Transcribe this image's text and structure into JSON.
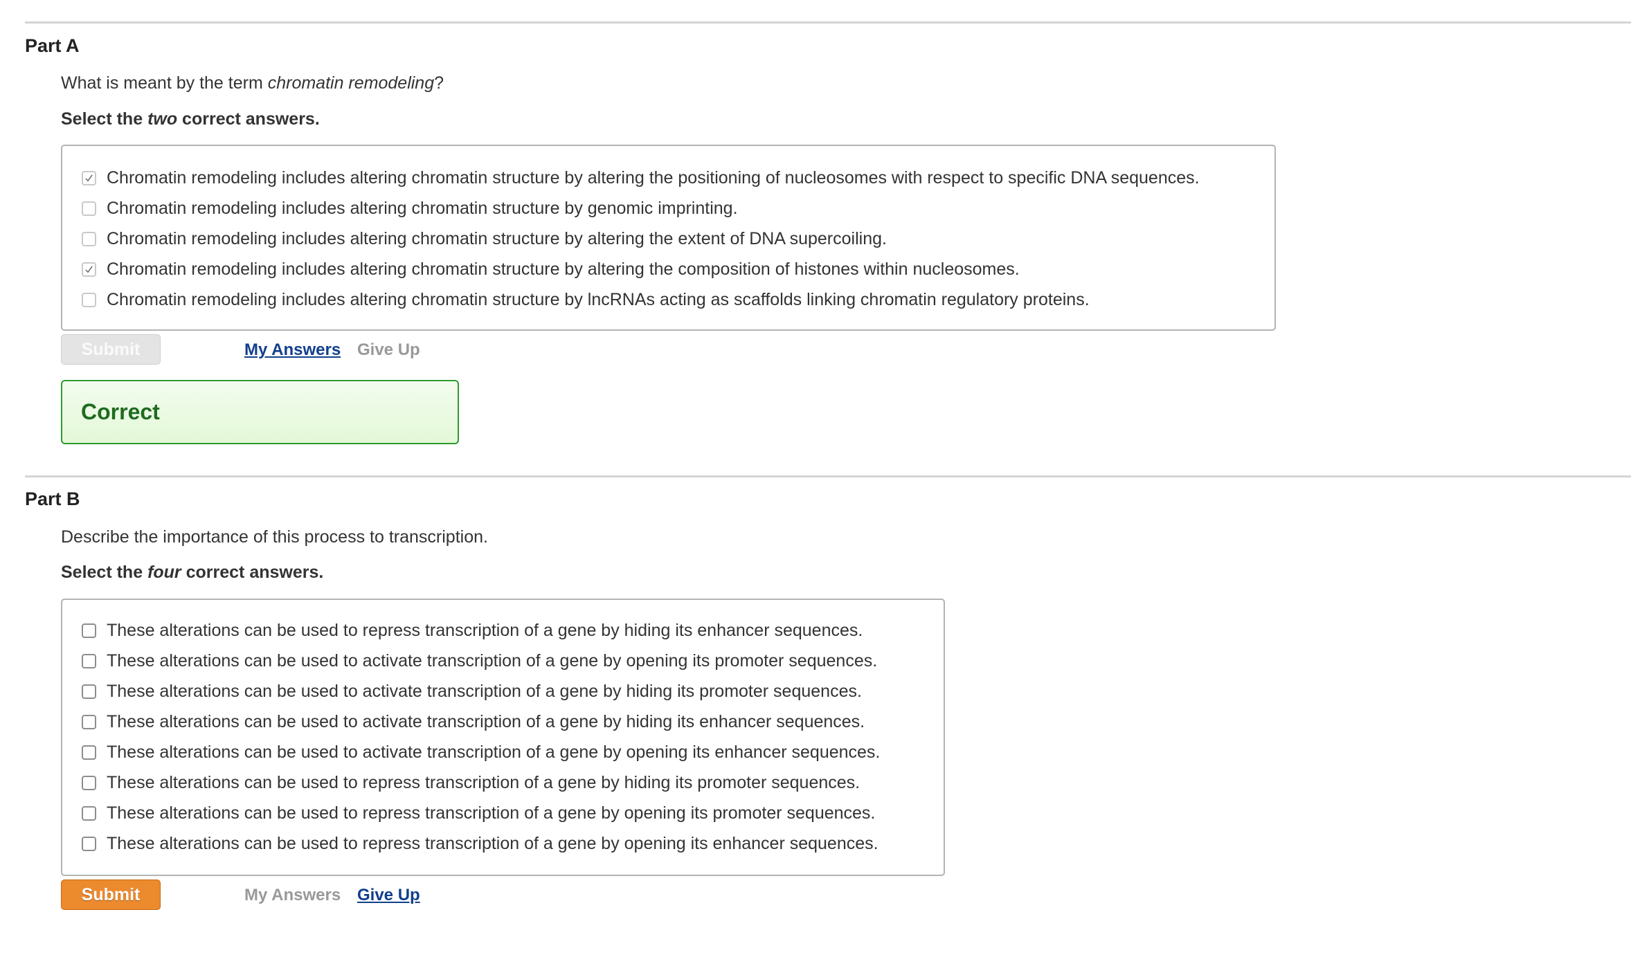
{
  "part_a": {
    "title": "Part A",
    "question_prefix": "What is meant by the term ",
    "question_term": "chromatin remodeling",
    "question_suffix": "?",
    "instruction_prefix": "Select the ",
    "instruction_emphasis": "two",
    "instruction_suffix": " correct answers.",
    "options": [
      {
        "label": "Chromatin remodeling includes altering chromatin structure by altering the positioning of nucleosomes with respect to specific DNA sequences.",
        "checked": true
      },
      {
        "label": "Chromatin remodeling includes altering chromatin structure by genomic imprinting.",
        "checked": false
      },
      {
        "label": "Chromatin remodeling includes altering chromatin structure by altering the extent of DNA supercoiling.",
        "checked": false
      },
      {
        "label": "Chromatin remodeling includes altering chromatin structure by altering the composition of histones within nucleosomes.",
        "checked": true
      },
      {
        "label": "Chromatin remodeling includes altering chromatin structure by lncRNAs acting as scaffolds linking chromatin regulatory proteins.",
        "checked": false
      }
    ],
    "submit_label": "Submit",
    "my_answers_label": "My Answers",
    "give_up_label": "Give Up",
    "feedback": "Correct"
  },
  "part_b": {
    "title": "Part B",
    "question": "Describe the importance of this process to transcription.",
    "instruction_prefix": "Select the ",
    "instruction_emphasis": "four",
    "instruction_suffix": " correct answers.",
    "options": [
      {
        "label": "These alterations can be used to repress transcription of a gene by hiding its enhancer sequences.",
        "checked": false
      },
      {
        "label": "These alterations can be used to activate transcription of a gene by opening its promoter sequences.",
        "checked": false
      },
      {
        "label": "These alterations can be used to activate transcription of a gene by hiding its promoter sequences.",
        "checked": false
      },
      {
        "label": "These alterations can be used to activate transcription of a gene by hiding its enhancer sequences.",
        "checked": false
      },
      {
        "label": "These alterations can be used to activate transcription of a gene by opening its enhancer sequences.",
        "checked": false
      },
      {
        "label": "These alterations can be used to repress transcription of a gene by hiding its promoter sequences.",
        "checked": false
      },
      {
        "label": "These alterations can be used to repress transcription of a gene by opening its promoter sequences.",
        "checked": false
      },
      {
        "label": "These alterations can be used to repress transcription of a gene by opening its enhancer sequences.",
        "checked": false
      }
    ],
    "submit_label": "Submit",
    "my_answers_label": "My Answers",
    "give_up_label": "Give Up"
  },
  "colors": {
    "submit_active": "#ec8a2e",
    "link_active": "#113f8c",
    "correct_text": "#1f6b1f",
    "correct_border": "#2e9a2e"
  }
}
